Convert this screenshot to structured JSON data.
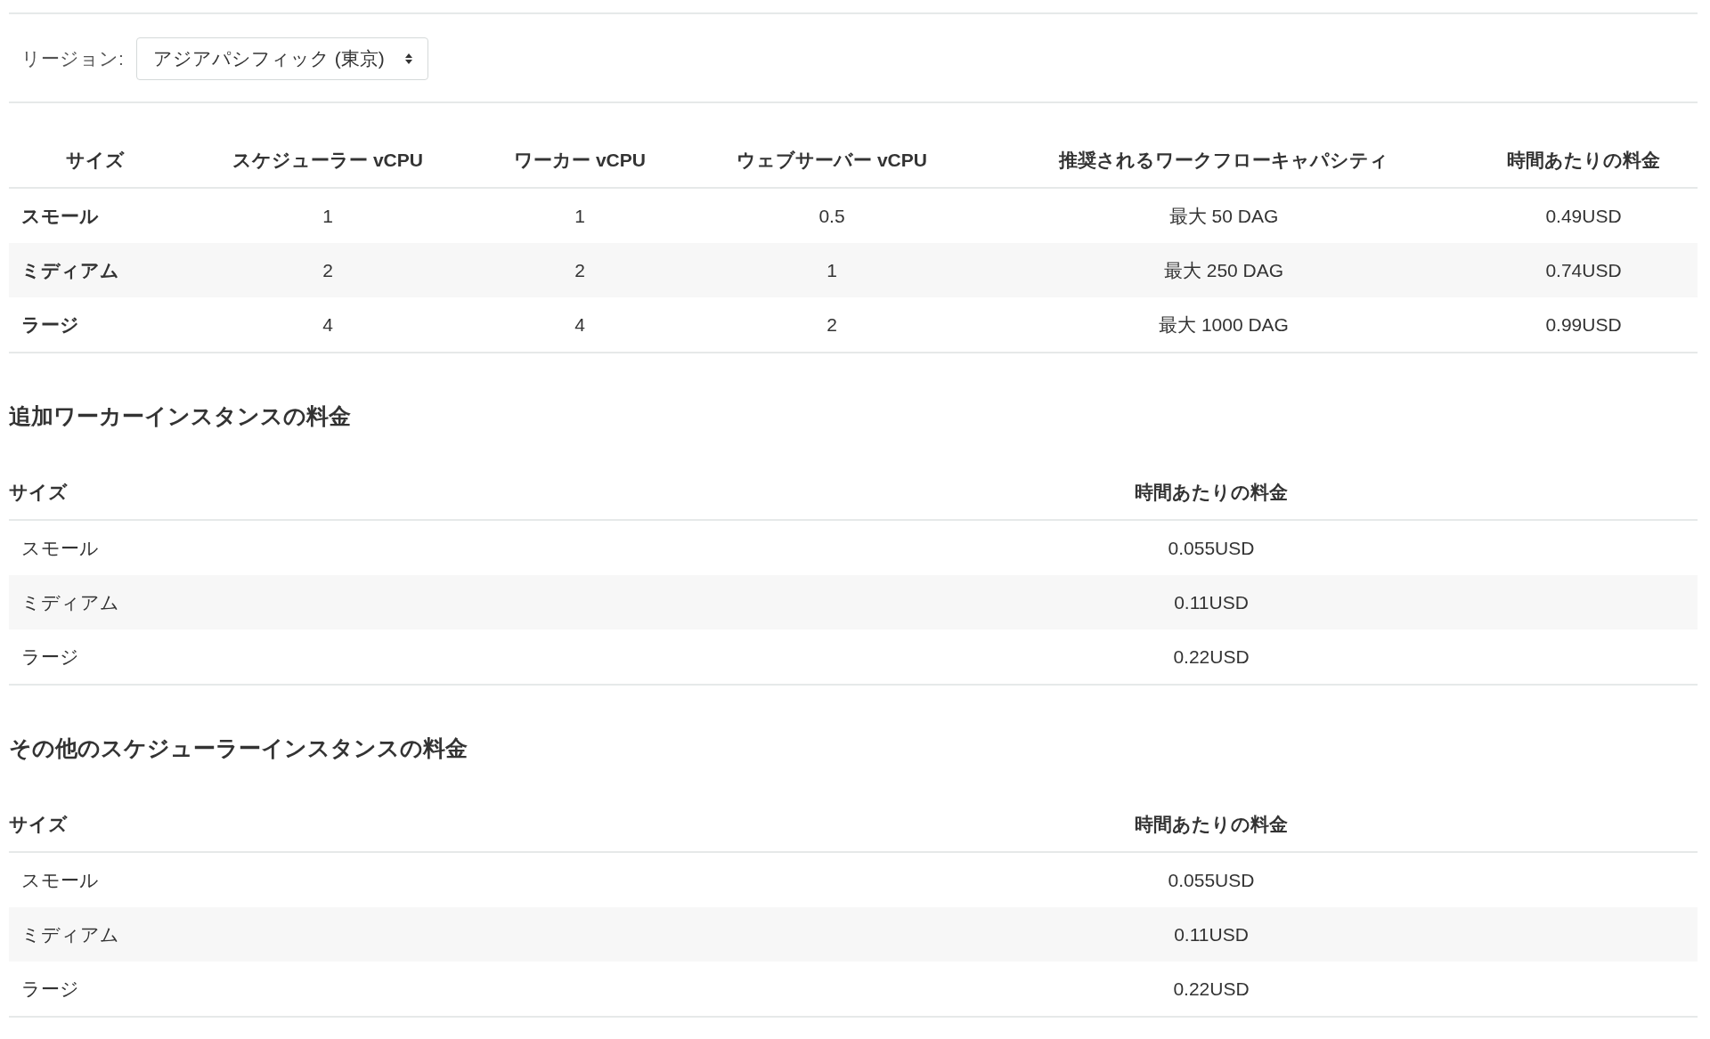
{
  "region": {
    "label": "リージョン:",
    "value": "アジアパシフィック (東京)"
  },
  "main_table": {
    "columns": [
      "サイズ",
      "スケジューラー vCPU",
      "ワーカー vCPU",
      "ウェブサーバー vCPU",
      "推奨されるワークフローキャパシティ",
      "時間あたりの料金"
    ],
    "rows": [
      [
        "スモール",
        "1",
        "1",
        "0.5",
        "最大 50 DAG",
        "0.49USD"
      ],
      [
        "ミディアム",
        "2",
        "2",
        "1",
        "最大 250 DAG",
        "0.74USD"
      ],
      [
        "ラージ",
        "4",
        "4",
        "2",
        "最大 1000 DAG",
        "0.99USD"
      ]
    ]
  },
  "sections": [
    {
      "heading": "追加ワーカーインスタンスの料金",
      "columns": [
        "サイズ",
        "時間あたりの料金"
      ],
      "rows": [
        [
          "スモール",
          "0.055USD"
        ],
        [
          "ミディアム",
          "0.11USD"
        ],
        [
          "ラージ",
          "0.22USD"
        ]
      ]
    },
    {
      "heading": "その他のスケジューラーインスタンスの料金",
      "columns": [
        "サイズ",
        "時間あたりの料金"
      ],
      "rows": [
        [
          "スモール",
          "0.055USD"
        ],
        [
          "ミディアム",
          "0.11USD"
        ],
        [
          "ラージ",
          "0.22USD"
        ]
      ]
    }
  ]
}
